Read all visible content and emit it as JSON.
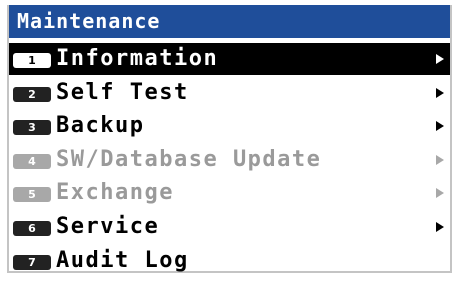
{
  "window": {
    "title": "Maintenance"
  },
  "menu": {
    "items": [
      {
        "number": "1",
        "label": "Information",
        "state": "selected",
        "has_submenu": true
      },
      {
        "number": "2",
        "label": "Self Test",
        "state": "enabled",
        "has_submenu": true
      },
      {
        "number": "3",
        "label": "Backup",
        "state": "enabled",
        "has_submenu": true
      },
      {
        "number": "4",
        "label": "SW/Database Update",
        "state": "disabled",
        "has_submenu": true
      },
      {
        "number": "5",
        "label": "Exchange",
        "state": "disabled",
        "has_submenu": true
      },
      {
        "number": "6",
        "label": "Service",
        "state": "enabled",
        "has_submenu": true
      },
      {
        "number": "7",
        "label": "Audit Log",
        "state": "enabled",
        "has_submenu": false
      }
    ]
  },
  "colors": {
    "title_bar": "#1f4e9a",
    "selected_background": "#000000",
    "disabled_text": "#9a9a9a"
  },
  "icons": {
    "submenu": "triangle-right-icon"
  }
}
